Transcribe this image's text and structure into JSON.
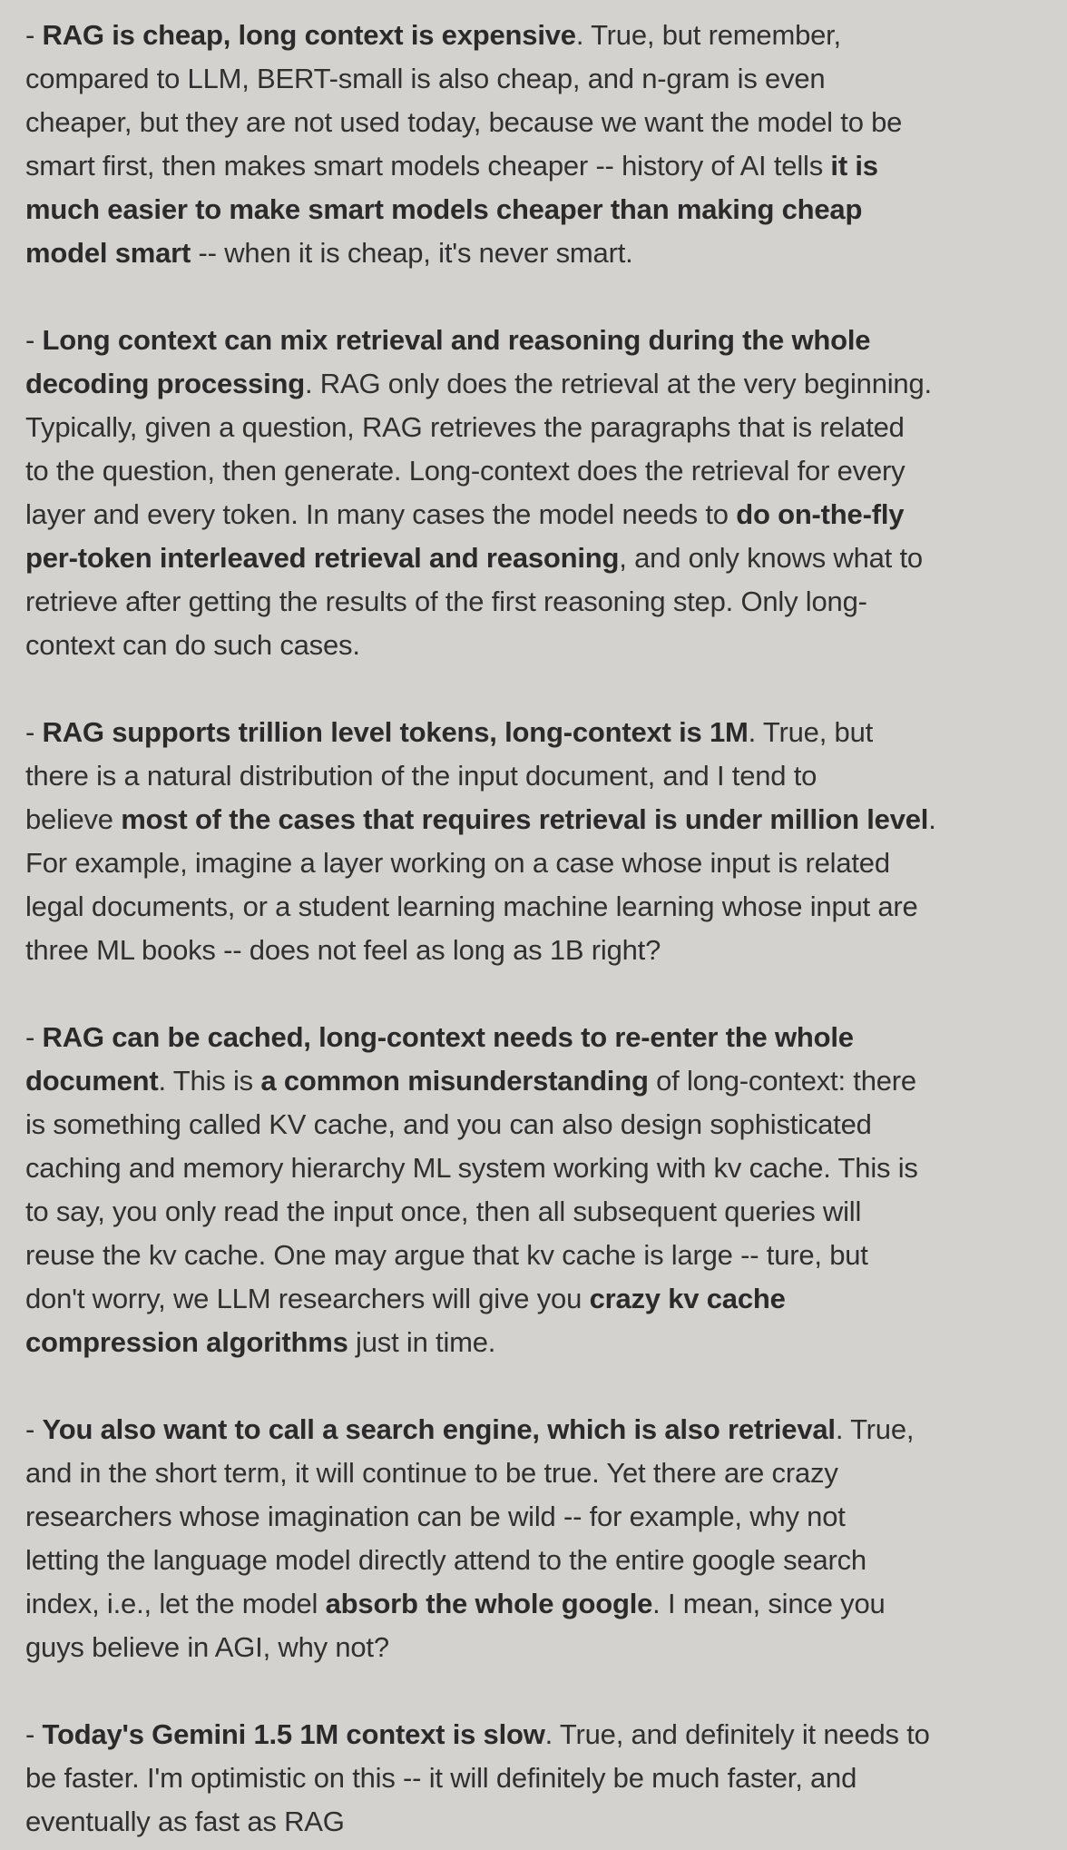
{
  "paragraphs": [
    [
      [
        {
          "t": "- "
        },
        {
          "t": "RAG is cheap, long context is expensive",
          "b": 1
        },
        {
          "t": ". True, but remember,"
        }
      ],
      [
        {
          "t": "compared to LLM, BERT-small is also cheap, and n-gram is even"
        }
      ],
      [
        {
          "t": "cheaper, but they are not used today, because we want the model to be"
        }
      ],
      [
        {
          "t": "smart first, then makes smart models cheaper -- history of AI tells "
        },
        {
          "t": "it is",
          "b": 1
        }
      ],
      [
        {
          "t": "much easier to make smart models cheaper than making cheap",
          "b": 1
        }
      ],
      [
        {
          "t": "model smart",
          "b": 1
        },
        {
          "t": " -- when it is cheap, it's never smart."
        }
      ]
    ],
    [
      [
        {
          "t": "- "
        },
        {
          "t": "Long context can mix retrieval and reasoning during the whole",
          "b": 1
        }
      ],
      [
        {
          "t": "decoding processing",
          "b": 1
        },
        {
          "t": ". RAG only does the retrieval at the very beginning."
        }
      ],
      [
        {
          "t": "Typically, given a question, RAG retrieves the paragraphs that is related"
        }
      ],
      [
        {
          "t": "to the question, then generate. Long-context does the retrieval for every"
        }
      ],
      [
        {
          "t": "layer and every token. In many cases the model needs to "
        },
        {
          "t": "do on-the-fly",
          "b": 1
        }
      ],
      [
        {
          "t": "per-token interleaved retrieval and reasoning",
          "b": 1
        },
        {
          "t": ", and only knows what to"
        }
      ],
      [
        {
          "t": "retrieve after getting the results of the first reasoning step. Only long-"
        }
      ],
      [
        {
          "t": "context can do such cases."
        }
      ]
    ],
    [
      [
        {
          "t": "- "
        },
        {
          "t": "RAG supports trillion level tokens, long-context is 1M",
          "b": 1
        },
        {
          "t": ". True, but"
        }
      ],
      [
        {
          "t": "there is a natural distribution of the input document, and I tend to"
        }
      ],
      [
        {
          "t": "believe "
        },
        {
          "t": "most of the cases that requires retrieval is under million level",
          "b": 1
        },
        {
          "t": "."
        }
      ],
      [
        {
          "t": "For example, imagine a layer working on a case whose input is related"
        }
      ],
      [
        {
          "t": "legal documents, or a student learning machine learning whose input are"
        }
      ],
      [
        {
          "t": "three ML books -- does not feel as long as 1B right?"
        }
      ]
    ],
    [
      [
        {
          "t": "- "
        },
        {
          "t": "RAG can be cached, long-context needs to re-enter the whole",
          "b": 1
        }
      ],
      [
        {
          "t": "document",
          "b": 1
        },
        {
          "t": ". This is "
        },
        {
          "t": "a common misunderstanding",
          "b": 1
        },
        {
          "t": " of long-context: there"
        }
      ],
      [
        {
          "t": "is something called KV cache, and you can also design sophisticated"
        }
      ],
      [
        {
          "t": "caching and memory hierarchy ML system working with kv cache. This is"
        }
      ],
      [
        {
          "t": "to say, you only read the input once, then all subsequent queries will"
        }
      ],
      [
        {
          "t": "reuse the kv cache. One may argue that kv cache is large -- ture, but"
        }
      ],
      [
        {
          "t": "don't worry, we LLM researchers will give you "
        },
        {
          "t": "crazy kv cache",
          "b": 1
        }
      ],
      [
        {
          "t": "compression algorithms",
          "b": 1
        },
        {
          "t": " just in time."
        }
      ]
    ],
    [
      [
        {
          "t": "- "
        },
        {
          "t": "You also want to call a search engine, which is also retrieval",
          "b": 1
        },
        {
          "t": ". True,"
        }
      ],
      [
        {
          "t": "and in the short term, it will continue to be true. Yet there are crazy"
        }
      ],
      [
        {
          "t": "researchers whose imagination can be wild --  for example, why not"
        }
      ],
      [
        {
          "t": "letting the language model directly attend to the entire google search"
        }
      ],
      [
        {
          "t": "index, i.e., let the model "
        },
        {
          "t": "absorb the whole google",
          "b": 1
        },
        {
          "t": ". I mean, since you"
        }
      ],
      [
        {
          "t": "guys believe in AGI, why not?"
        }
      ]
    ],
    [
      [
        {
          "t": "- "
        },
        {
          "t": "Today's Gemini 1.5 1M context is slow",
          "b": 1
        },
        {
          "t": ". True, and definitely it needs to"
        }
      ],
      [
        {
          "t": "be faster. I'm optimistic on this -- it will definitely be much faster, and"
        }
      ],
      [
        {
          "t": "eventually as fast as RAG"
        }
      ]
    ]
  ]
}
